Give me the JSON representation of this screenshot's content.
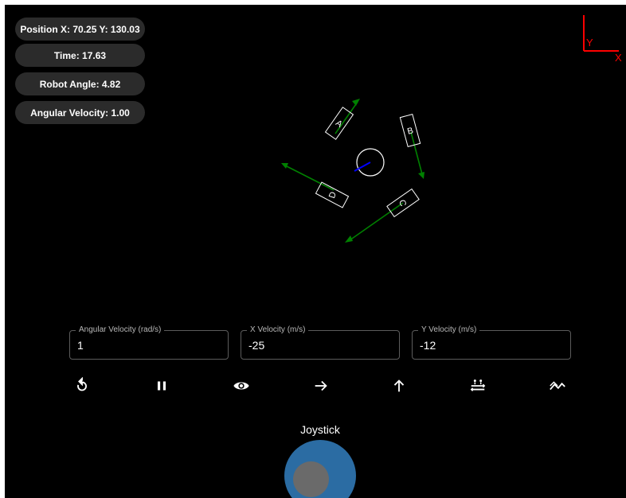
{
  "stats": {
    "position": "Position X: 70.25 Y: 130.03",
    "time": "Time: 17.63",
    "robot_angle": "Robot Angle: 4.82",
    "angular_velocity": "Angular Velocity: 1.00"
  },
  "axes": {
    "y_label": "Y",
    "x_label": "X",
    "color": "#ff0000"
  },
  "robot": {
    "wheels": [
      {
        "label": "A"
      },
      {
        "label": "B"
      },
      {
        "label": "C"
      },
      {
        "label": "D"
      }
    ],
    "force_color": "#008000",
    "heading_color": "#0000ff"
  },
  "inputs": {
    "angular_velocity": {
      "label": "Angular Velocity (rad/s)",
      "value": "1"
    },
    "x_velocity": {
      "label": "X Velocity (m/s)",
      "value": "-25"
    },
    "y_velocity": {
      "label": "Y Velocity (m/s)",
      "value": "-12"
    }
  },
  "controls": [
    {
      "icon": "reset-icon"
    },
    {
      "icon": "pause-icon"
    },
    {
      "icon": "eye-icon"
    },
    {
      "icon": "arrow-right-icon"
    },
    {
      "icon": "arrow-up-icon"
    },
    {
      "icon": "strafe-icon"
    },
    {
      "icon": "zigzag-icon"
    }
  ],
  "joystick": {
    "label": "Joystick",
    "base_color": "#2b6ca3",
    "knob_color": "#6a6a6a"
  }
}
